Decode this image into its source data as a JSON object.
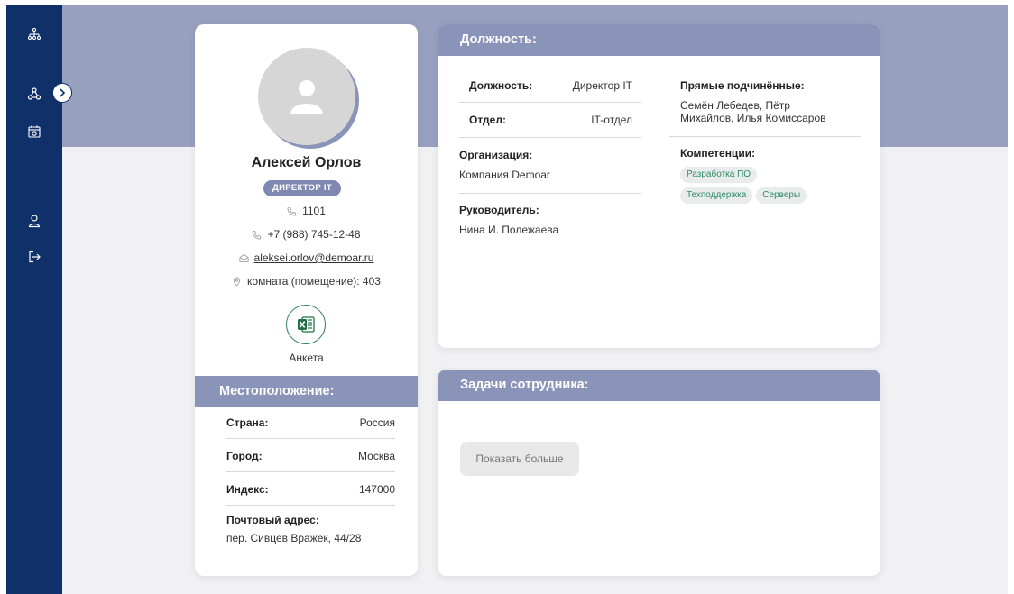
{
  "sidebar": {
    "icons": [
      "org-structure-icon",
      "network-icon",
      "calendar-icon",
      "user-icon",
      "logout-icon"
    ]
  },
  "colors": {
    "sidebar_bg": "#10306a",
    "banner_bg": "#97a1bf",
    "section_header_bg": "#8a93b8",
    "tag_text": "#2f8c64"
  },
  "profile": {
    "name": "Алексей Орлов",
    "role_badge": "ДИРЕКТОР IT",
    "extension": "1101",
    "phone": "+7 (988) 745-12-48",
    "email": "aleksei.orlov@demoar.ru",
    "room": "комната (помещение): 403",
    "form_label": "Анкета"
  },
  "location": {
    "header": "Местоположение:",
    "rows": [
      {
        "label": "Страна:",
        "value": "Россия"
      },
      {
        "label": "Город:",
        "value": "Москва"
      },
      {
        "label": "Индекс:",
        "value": "147000"
      }
    ],
    "address_label": "Почтовый адрес:",
    "address_value": "пер. Сивцев Вражек, 44/28"
  },
  "job": {
    "header": "Должность:",
    "position_label": "Должность:",
    "position_value": "Директор IT",
    "department_label": "Отдел:",
    "department_value": "IT-отдел",
    "organization_label": "Организация:",
    "organization_value": "Компания Demoar",
    "manager_label": "Руководитель:",
    "manager_value": "Нина И. Полежаева",
    "subordinates_label": "Прямые подчинённые:",
    "subordinates_line1": "Семён Лебедев, Пётр",
    "subordinates_line2": "Михайлов, Илья Комиссаров",
    "competencies_label": "Компетенции:",
    "competencies": [
      "Разработка ПО",
      "Техподдержка",
      "Серверы"
    ]
  },
  "tasks": {
    "header": "Задачи сотрудника:",
    "show_more": "Показать больше"
  }
}
